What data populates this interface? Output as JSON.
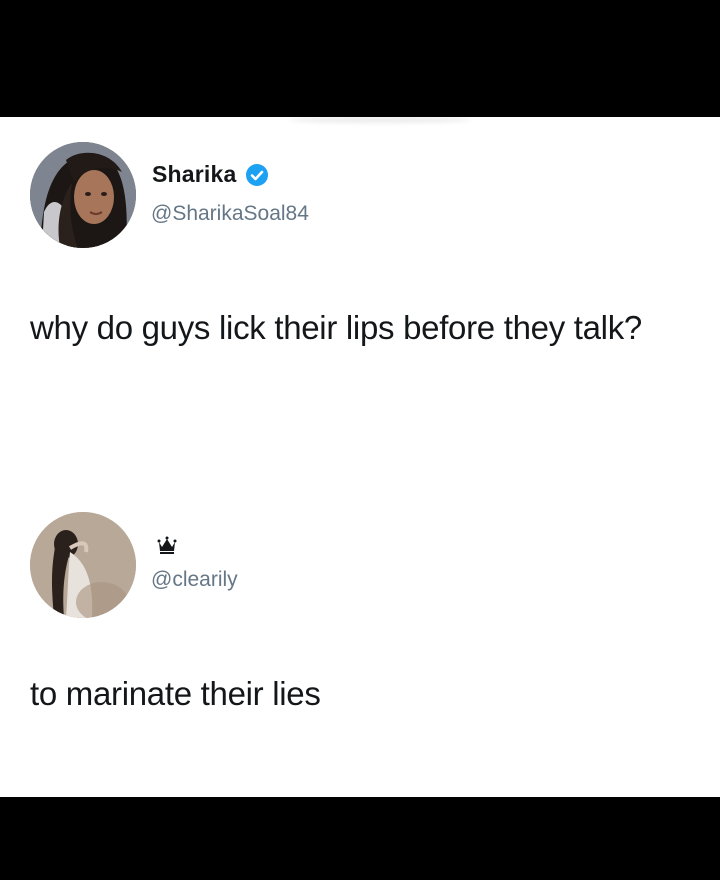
{
  "tweet": {
    "author": {
      "display_name": "Sharika",
      "handle": "@SharikaSoal84",
      "verified": true,
      "avatar_icon": "profile-photo-woman-dark-hair"
    },
    "text": "why do guys lick their lips before they talk?"
  },
  "reply": {
    "author": {
      "display_name_icon": "crown-icon",
      "handle": "@clearily",
      "avatar_icon": "profile-photo-figure"
    },
    "text": "to marinate their lies"
  },
  "colors": {
    "background": "#000000",
    "card": "#ffffff",
    "text": "#14171a",
    "handle": "#657786",
    "verified_badge": "#1da1f2"
  }
}
